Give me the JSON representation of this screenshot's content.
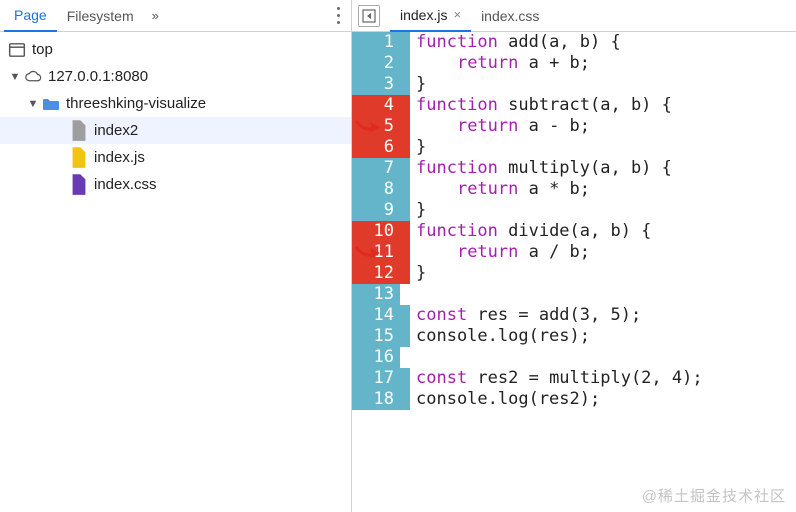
{
  "panelTabs": {
    "page": "Page",
    "filesystem": "Filesystem",
    "overflow": "»"
  },
  "tree": {
    "top": "top",
    "host": "127.0.0.1:8080",
    "project": "threeshking-visualize",
    "files": [
      "index2",
      "index.js",
      "index.css"
    ]
  },
  "editorTabs": {
    "active": "index.js",
    "inactive": "index.css",
    "close": "×"
  },
  "icons": {
    "twisty_open": "▼",
    "twisty_right": "▶"
  },
  "code": {
    "lines": [
      {
        "n": 1,
        "num": "blue",
        "bar": "blue",
        "kw": "function",
        "rest": " add(a, b) {"
      },
      {
        "n": 2,
        "num": "blue",
        "bar": "blue",
        "kw": "    return",
        "rest": " a + b;"
      },
      {
        "n": 3,
        "num": "blue",
        "bar": "blue",
        "kw": "",
        "rest": "}"
      },
      {
        "n": 4,
        "num": "red",
        "bar": "red",
        "kw": "function",
        "rest": " subtract(a, b) {"
      },
      {
        "n": 5,
        "num": "red",
        "bar": "red",
        "kw": "    return",
        "rest": " a - b;"
      },
      {
        "n": 6,
        "num": "red",
        "bar": "red",
        "kw": "",
        "rest": "}"
      },
      {
        "n": 7,
        "num": "blue",
        "bar": "blue",
        "kw": "function",
        "rest": " multiply(a, b) {"
      },
      {
        "n": 8,
        "num": "blue",
        "bar": "blue",
        "kw": "    return",
        "rest": " a * b;"
      },
      {
        "n": 9,
        "num": "blue",
        "bar": "blue",
        "kw": "",
        "rest": "}"
      },
      {
        "n": 10,
        "num": "red",
        "bar": "red",
        "kw": "function",
        "rest": " divide(a, b) {"
      },
      {
        "n": 11,
        "num": "red",
        "bar": "red",
        "kw": "    return",
        "rest": " a / b;"
      },
      {
        "n": 12,
        "num": "red",
        "bar": "red",
        "kw": "",
        "rest": "}"
      },
      {
        "n": 13,
        "num": "blue",
        "bar": "",
        "kw": "",
        "rest": ""
      },
      {
        "n": 14,
        "num": "blue",
        "bar": "blue",
        "kw": "const",
        "rest": " res = add(3, 5);"
      },
      {
        "n": 15,
        "num": "blue",
        "bar": "blue",
        "kw": "",
        "rest": "console.log(res);"
      },
      {
        "n": 16,
        "num": "blue",
        "bar": "",
        "kw": "",
        "rest": ""
      },
      {
        "n": 17,
        "num": "blue",
        "bar": "blue",
        "kw": "const",
        "rest": " res2 = multiply(2, 4);"
      },
      {
        "n": 18,
        "num": "blue",
        "bar": "blue",
        "kw": "",
        "rest": "console.log(res2);"
      }
    ]
  },
  "annotations": {
    "arrow1_line": 5,
    "arrow2_line": 11
  },
  "watermark": "@稀土掘金技术社区"
}
